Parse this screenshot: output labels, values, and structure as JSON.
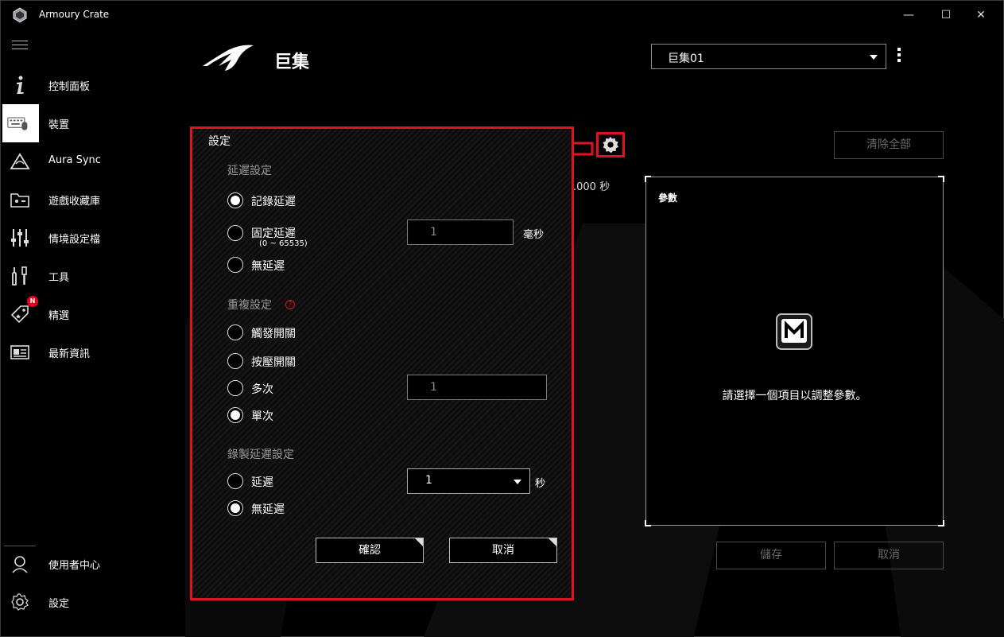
{
  "app": {
    "title": "Armoury Crate"
  },
  "window_controls": {
    "minimize": "—",
    "maximize": "☐",
    "close": "✕"
  },
  "sidebar": {
    "items": [
      {
        "label": "控制面板",
        "icon": "info-icon"
      },
      {
        "label": "裝置",
        "icon": "keyboard-mouse-icon",
        "active": true
      },
      {
        "label": "Aura Sync",
        "icon": "aura-sync-icon"
      },
      {
        "label": "遊戲收藏庫",
        "icon": "game-library-icon"
      },
      {
        "label": "情境設定檔",
        "icon": "sliders-icon"
      },
      {
        "label": "工具",
        "icon": "tools-icon"
      },
      {
        "label": "精選",
        "icon": "tag-icon",
        "badge": "N"
      },
      {
        "label": "最新資訊",
        "icon": "news-icon"
      }
    ],
    "bottom_items": [
      {
        "label": "使用者中心",
        "icon": "user-center-icon"
      },
      {
        "label": "設定",
        "icon": "gear-icon"
      }
    ]
  },
  "header": {
    "title": "巨集",
    "macro_select_value": "巨集01"
  },
  "toolbar": {
    "clear_all": "清除全部",
    "time_readout": ".000 秒"
  },
  "params": {
    "title": "參數",
    "hint": "請選擇一個項目以調整參數。"
  },
  "footer": {
    "save": "儲存",
    "cancel": "取消"
  },
  "dialog": {
    "title": "設定",
    "delay_section": {
      "title": "延遲設定",
      "options": [
        "記錄延遲",
        "固定延遲",
        "無延遲"
      ],
      "range_note": "(0 ~ 65535)",
      "fixed_value": "1",
      "unit": "毫秒",
      "selected": "記錄延遲"
    },
    "repeat_section": {
      "title": "重複設定",
      "help": "?",
      "options": [
        "觸發開關",
        "按壓開關",
        "多次",
        "單次"
      ],
      "multiple_value": "1",
      "selected": "單次"
    },
    "record_delay_section": {
      "title": "錄製延遲設定",
      "options": [
        "延遲",
        "無延遲"
      ],
      "delay_value": "1",
      "unit": "秒",
      "selected": "無延遲"
    },
    "confirm": "確認",
    "cancel": "取消"
  },
  "colors": {
    "accent": "#e3101f",
    "background": "#000000"
  }
}
